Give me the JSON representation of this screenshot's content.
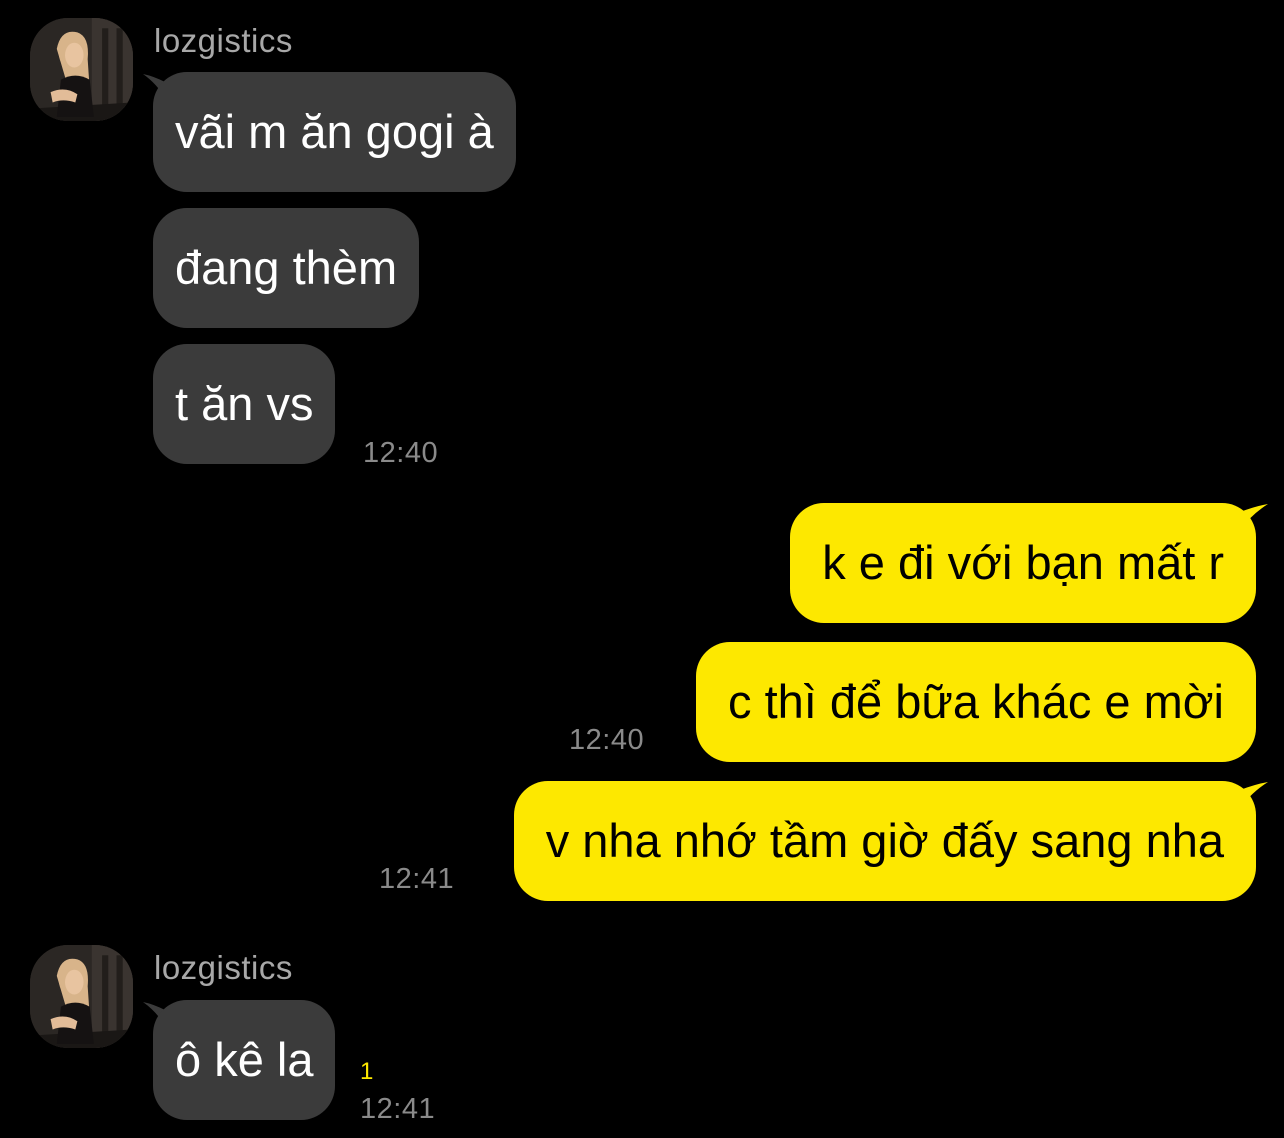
{
  "colors": {
    "background": "#000000",
    "incoming_bubble": "#3b3b3b",
    "outgoing_bubble": "#fde800",
    "timestamp": "#8a8a8a",
    "sender_name": "#a8a8a8",
    "unread_count": "#fde800"
  },
  "groups": [
    {
      "direction": "incoming",
      "sender": "lozgistics",
      "avatar_icon": "profile-photo-avatar",
      "messages": [
        "vãi m ăn gogi à",
        "đang thèm",
        "t ăn vs"
      ],
      "time": "12:40"
    },
    {
      "direction": "outgoing",
      "messages": [
        "k e đi với bạn mất r",
        "c thì để bữa khác e mời"
      ],
      "time": "12:40"
    },
    {
      "direction": "outgoing",
      "messages": [
        "v nha nhớ tầm giờ đấy sang nha"
      ],
      "time": "12:41"
    },
    {
      "direction": "incoming",
      "sender": "lozgistics",
      "avatar_icon": "profile-photo-avatar",
      "messages": [
        "ô kê la"
      ],
      "time": "12:41",
      "unread_count": "1"
    }
  ]
}
